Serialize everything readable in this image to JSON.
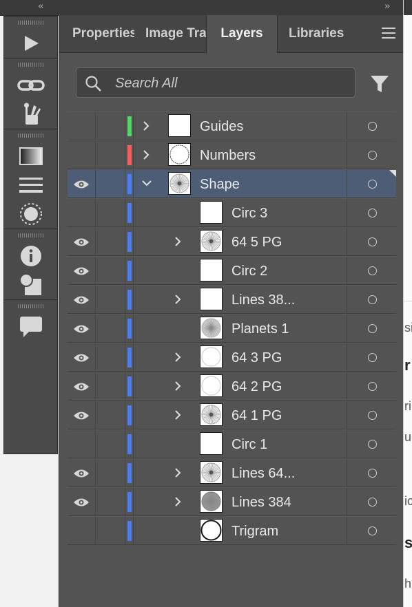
{
  "topbar": {
    "collapse_left": "‹‹",
    "collapse_right": "››"
  },
  "tabs": [
    {
      "label": "Properties",
      "active": false
    },
    {
      "label": "Image Trace",
      "active": false
    },
    {
      "label": "Layers",
      "active": true
    },
    {
      "label": "Libraries",
      "active": false
    }
  ],
  "search": {
    "placeholder": "Search All",
    "value": ""
  },
  "colors": {
    "panel": "#535353",
    "selected_row": "#4c5d75",
    "green": "#4cd964",
    "red": "#ff5b5b",
    "blue": "#4a7cf6"
  },
  "toolstrip_icons": [
    "play-icon",
    "link-icon",
    "brush-tools-icon",
    "gradient-icon",
    "stroke-icon",
    "appearance-icon",
    "info-icon",
    "transform-icon",
    "comments-icon"
  ],
  "right_panel_fragments": [
    "si",
    "r",
    "ri",
    "u",
    "ic",
    "s",
    "h"
  ],
  "layers": [
    {
      "name": "Guides",
      "color": "green",
      "visible": false,
      "expandable": true,
      "expanded": false,
      "indent": 0,
      "thumb": "blank",
      "selected": false
    },
    {
      "name": "Numbers",
      "color": "red",
      "visible": false,
      "expandable": true,
      "expanded": false,
      "indent": 0,
      "thumb": "dashed-circle",
      "selected": false
    },
    {
      "name": "Shape",
      "color": "blue",
      "visible": true,
      "expandable": true,
      "expanded": true,
      "indent": 0,
      "thumb": "radial",
      "selected": true
    },
    {
      "name": "Circ 3",
      "color": "blue",
      "visible": false,
      "expandable": false,
      "indent": 1,
      "thumb": "blank",
      "selected": false
    },
    {
      "name": "64 5 PG",
      "color": "blue",
      "visible": true,
      "expandable": true,
      "expanded": false,
      "indent": 1,
      "thumb": "radial",
      "selected": false
    },
    {
      "name": "Circ 2",
      "color": "blue",
      "visible": true,
      "expandable": false,
      "indent": 1,
      "thumb": "blank",
      "selected": false
    },
    {
      "name": "Lines 38...",
      "color": "blue",
      "visible": true,
      "expandable": true,
      "expanded": false,
      "indent": 1,
      "thumb": "blank",
      "selected": false
    },
    {
      "name": "Planets 1",
      "color": "blue",
      "visible": true,
      "expandable": false,
      "indent": 1,
      "thumb": "radial-light",
      "selected": false
    },
    {
      "name": "64 3 PG",
      "color": "blue",
      "visible": true,
      "expandable": true,
      "expanded": false,
      "indent": 1,
      "thumb": "faint-circle",
      "selected": false
    },
    {
      "name": "64 2 PG",
      "color": "blue",
      "visible": true,
      "expandable": true,
      "expanded": false,
      "indent": 1,
      "thumb": "faint-circle",
      "selected": false
    },
    {
      "name": "64 1 PG",
      "color": "blue",
      "visible": true,
      "expandable": true,
      "expanded": false,
      "indent": 1,
      "thumb": "radial",
      "selected": false
    },
    {
      "name": "Circ 1",
      "color": "blue",
      "visible": false,
      "expandable": false,
      "indent": 1,
      "thumb": "blank",
      "selected": false
    },
    {
      "name": "Lines 64...",
      "color": "blue",
      "visible": true,
      "expandable": true,
      "expanded": false,
      "indent": 1,
      "thumb": "radial",
      "selected": false
    },
    {
      "name": "Lines 384",
      "color": "blue",
      "visible": true,
      "expandable": true,
      "expanded": false,
      "indent": 1,
      "thumb": "radial-dark",
      "selected": false
    },
    {
      "name": "Trigram",
      "color": "blue",
      "visible": false,
      "expandable": false,
      "indent": 1,
      "thumb": "solid-circle",
      "selected": false
    }
  ]
}
